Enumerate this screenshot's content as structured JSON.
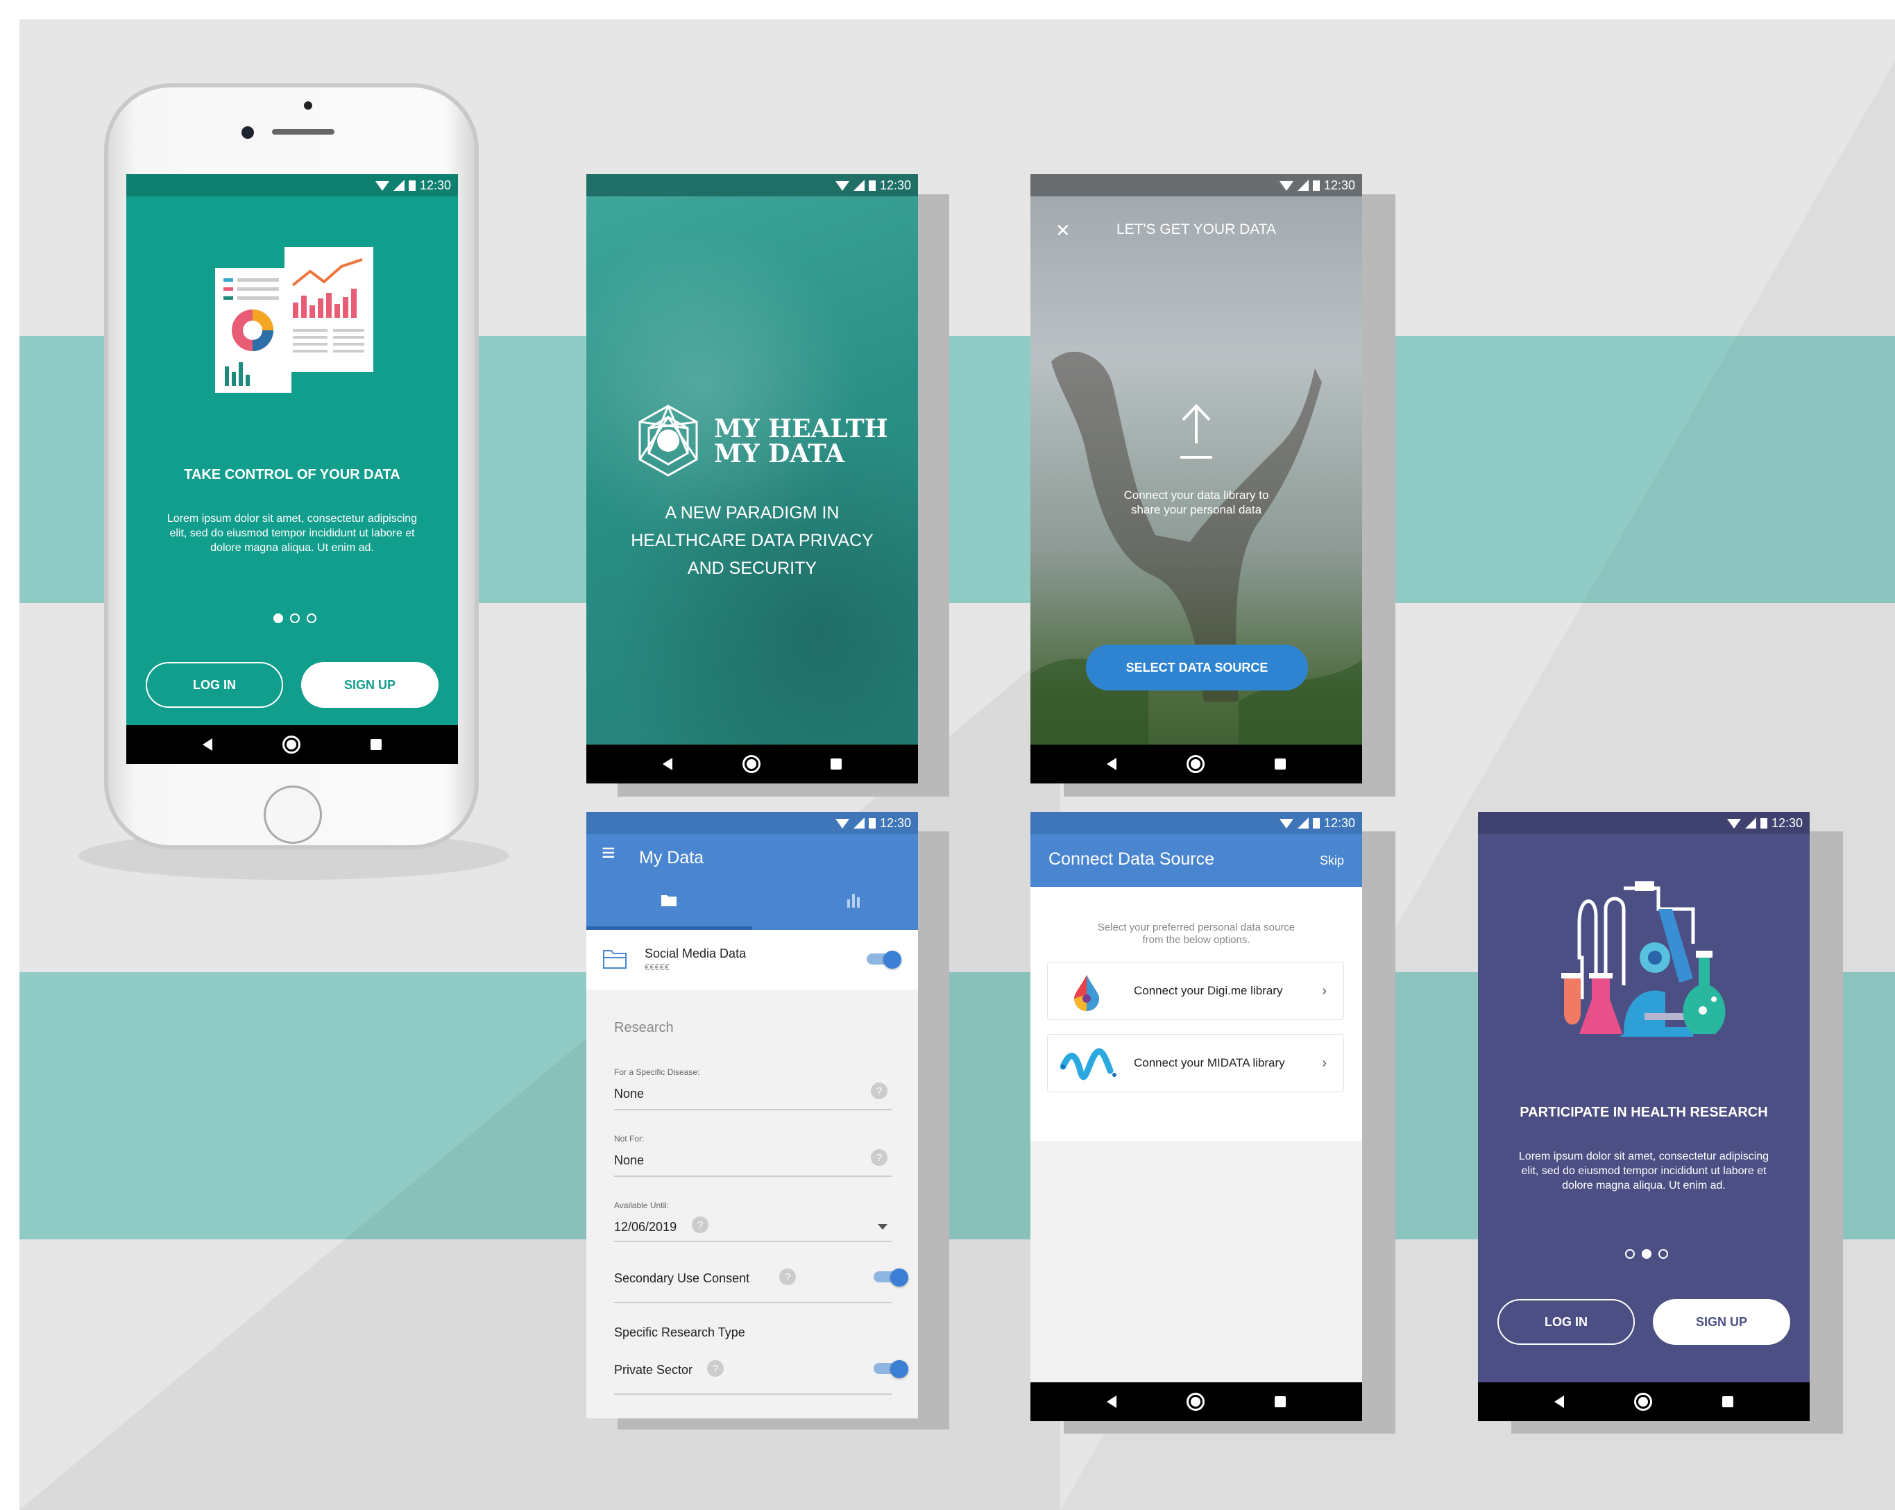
{
  "colors": {
    "teal": "#129e8c",
    "teal_dark": "#0f7f70",
    "blue": "#4a86cf",
    "blue_dark": "#3e76b9",
    "purple": "#4c4f83",
    "purple_dark": "#3f426e",
    "button_blue": "#2f84d2",
    "band": "#91cbc5",
    "bg": "#e6e6e6"
  },
  "status": {
    "time": "12:30",
    "icons": [
      "wifi-icon",
      "signal-icon",
      "battery-icon"
    ]
  },
  "nav": {
    "icons": [
      "back-icon",
      "home-icon",
      "recents-icon"
    ]
  },
  "screen1": {
    "title": "TAKE CONTROL OF YOUR DATA",
    "body": "Lorem ipsum dolor sit amet, consectetur adipiscing elit, sed do eiusmod tempor incididunt ut labore et dolore magna aliqua. Ut enim ad.",
    "login": "LOG IN",
    "signup": "SIGN UP",
    "active_page": 1,
    "page_count": 3
  },
  "screen2": {
    "logo_line1": "MY HEALTH",
    "logo_line2": "MY DATA",
    "tagline_1": "A NEW PARADIGM IN",
    "tagline_2": "HEALTHCARE DATA PRIVACY",
    "tagline_3": "AND SECURITY"
  },
  "screen3": {
    "title": "LET'S GET YOUR DATA",
    "caption_1": "Connect your data library to",
    "caption_2": "share your personal data",
    "button": "SELECT DATA SOURCE"
  },
  "screen4": {
    "title": "My Data",
    "tabs": [
      "folder-icon",
      "bar-chart-icon"
    ],
    "item_title": "Social Media Data",
    "item_sub": "€€€€€",
    "section": "Research",
    "f1_label": "For a Specific Disease:",
    "f1_value": "None",
    "f2_label": "Not For:",
    "f2_value": "None",
    "f3_label": "Available Until:",
    "f3_value": "12/06/2019",
    "consent": "Secondary Use Consent",
    "type_label": "Specific Research Type",
    "private": "Private Sector",
    "qmark": "?"
  },
  "screen5": {
    "title": "Connect Data Source",
    "skip": "Skip",
    "intro_1": "Select your preferred personal data source",
    "intro_2": "from the below options.",
    "options": [
      "Connect your Digi.me library",
      "Connect your MIDATA library"
    ],
    "chevron": "›"
  },
  "screen6": {
    "title": "PARTICIPATE IN HEALTH RESEARCH",
    "body": "Lorem ipsum dolor sit amet, consectetur adipiscing elit, sed do eiusmod tempor incididunt ut labore et dolore magna aliqua. Ut enim ad.",
    "login": "LOG IN",
    "signup": "SIGN UP",
    "active_page": 2,
    "page_count": 3
  },
  "close_glyph": "✕",
  "menu_glyph": "≡"
}
